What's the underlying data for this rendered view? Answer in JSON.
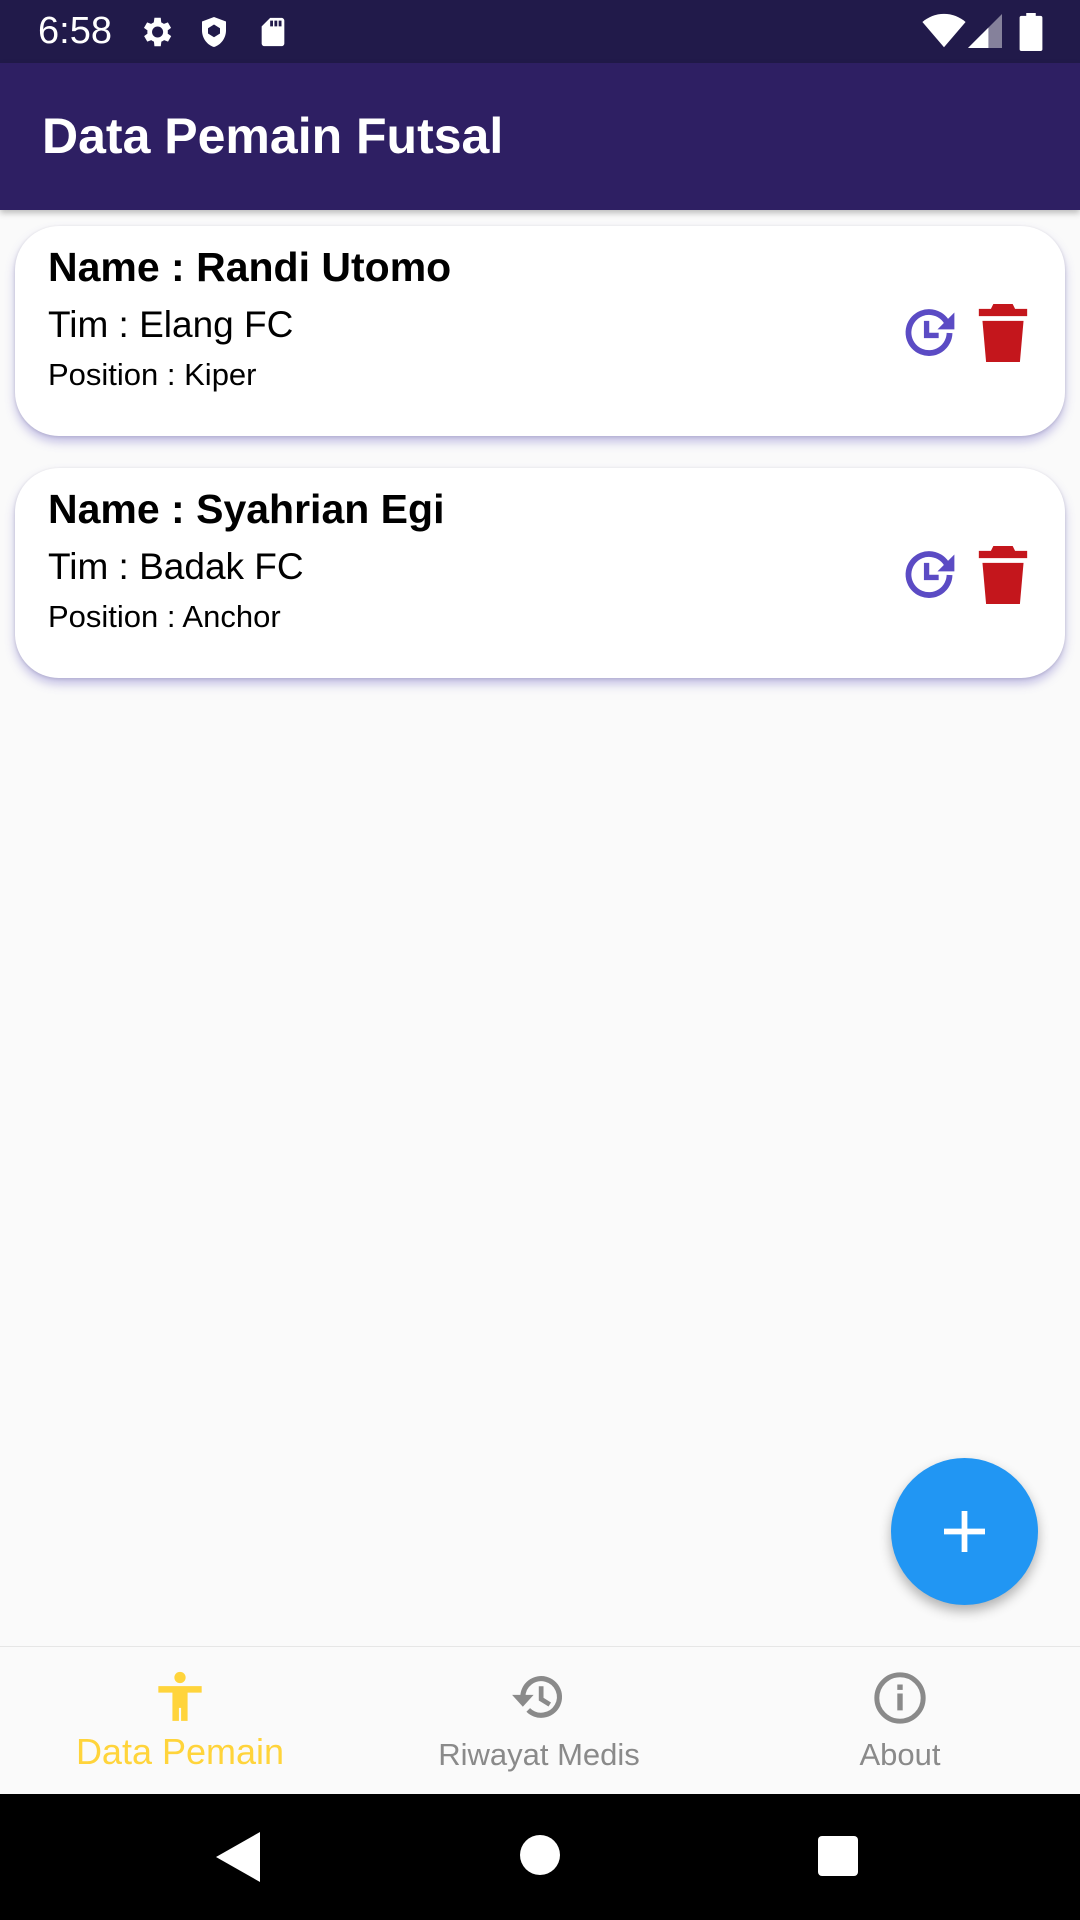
{
  "status_bar": {
    "time": "6:58",
    "icons": [
      "settings-icon",
      "shield-icon",
      "sd-card-icon",
      "wifi-icon",
      "signal-icon",
      "battery-icon"
    ]
  },
  "app_bar": {
    "title": "Data Pemain Futsal"
  },
  "players": [
    {
      "name": "Name : Randi Utomo",
      "team": "Tim : Elang FC",
      "position": "Position : Kiper"
    },
    {
      "name": "Name : Syahrian Egi",
      "team": "Tim : Badak FC",
      "position": "Position : Anchor"
    }
  ],
  "card_actions": {
    "history_icon": "history-icon",
    "delete_icon": "delete-icon"
  },
  "fab": {
    "icon": "plus-icon"
  },
  "bottom_nav": {
    "items": [
      {
        "label": "Data Pemain",
        "icon": "accessibility-icon",
        "active": true
      },
      {
        "label": "Riwayat Medis",
        "icon": "history-icon",
        "active": false
      },
      {
        "label": "About",
        "icon": "info-icon",
        "active": false
      }
    ]
  },
  "colors": {
    "status_bar": "#211a4a",
    "app_bar": "#2e1f63",
    "history_icon": "#5b4bc4",
    "delete_icon": "#c4161c",
    "fab": "#2196f3",
    "nav_active": "#ffd43b",
    "nav_inactive": "#8a8a8a"
  }
}
